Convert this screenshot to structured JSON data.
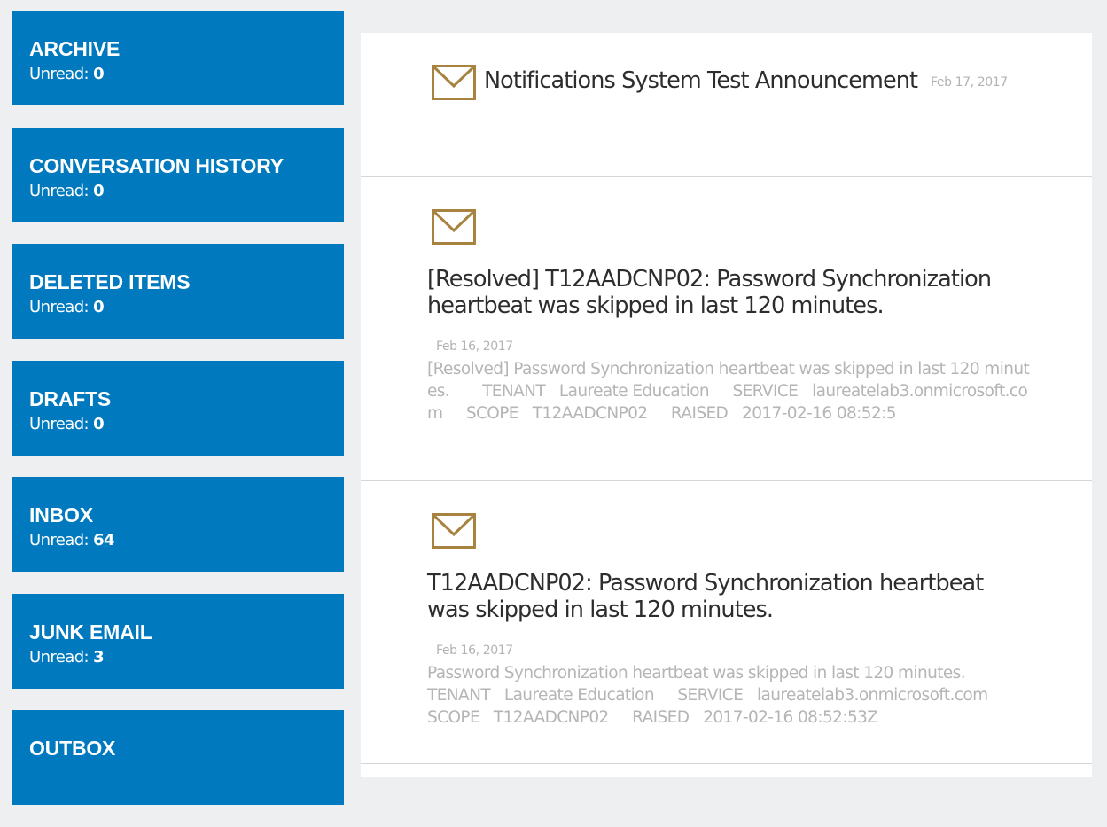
{
  "sidebar": {
    "unread_label": "Unread:",
    "folders": [
      {
        "name": "ARCHIVE",
        "unread": "0"
      },
      {
        "name": "CONVERSATION HISTORY",
        "unread": "0"
      },
      {
        "name": "DELETED ITEMS",
        "unread": "0"
      },
      {
        "name": "DRAFTS",
        "unread": "0"
      },
      {
        "name": "INBOX",
        "unread": "64"
      },
      {
        "name": "JUNK EMAIL",
        "unread": "3"
      },
      {
        "name": "OUTBOX",
        "unread": ""
      }
    ]
  },
  "messages": [
    {
      "icon": "envelope-icon",
      "subject": "Notifications System Test Announcement",
      "date": "Feb 17, 2017",
      "preview": ""
    },
    {
      "icon": "envelope-icon",
      "subject": "[Resolved] T12AADCNP02: Password Synchronization heartbeat was skipped in last 120 minutes.",
      "date": "Feb 16, 2017",
      "preview": "[Resolved] Password Synchronization heartbeat was skipped in last 120 minutes.       TENANT   Laureate Education     SERVICE   laureatelab3.onmicrosoft.com     SCOPE   T12AADCNP02     RAISED   2017-02-16 08:52:5"
    },
    {
      "icon": "envelope-icon",
      "subject": "T12AADCNP02: Password Synchronization heartbeat was skipped in last 120 minutes.",
      "date": "Feb 16, 2017",
      "preview": "Password Synchronization heartbeat was skipped in last 120 minutes.\nTENANT   Laureate Education     SERVICE   laureatelab3.onmicrosoft.com\nSCOPE   T12AADCNP02     RAISED   2017-02-16 08:52:53Z"
    }
  ],
  "colors": {
    "folder_bg": "#0079bf",
    "envelope": "#a8823f",
    "page_bg": "#eeeff1"
  }
}
